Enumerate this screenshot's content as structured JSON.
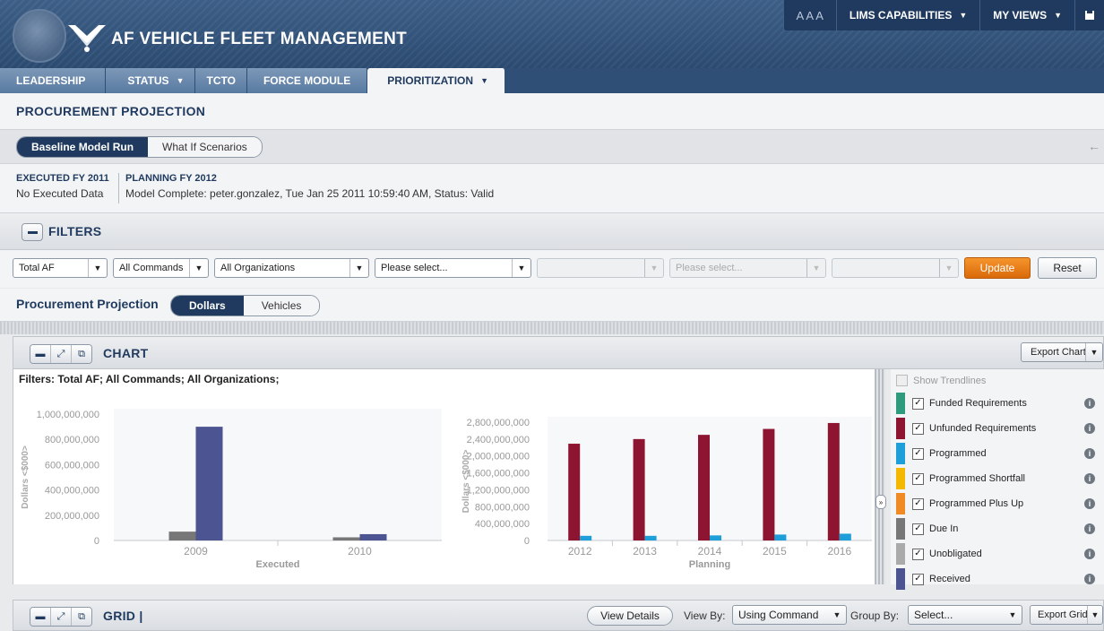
{
  "header": {
    "app_title": "AF VEHICLE FLEET MANAGEMENT",
    "font_size_control": "A A A",
    "menu": [
      "LIMS CAPABILITIES",
      "MY VIEWS"
    ]
  },
  "tabs": [
    {
      "label": "LEADERSHIP",
      "dropdown": false
    },
    {
      "label": "STATUS",
      "dropdown": true
    },
    {
      "label": "TCTO",
      "dropdown": false
    },
    {
      "label": "FORCE MODULE",
      "dropdown": false
    },
    {
      "label": "PRIORITIZATION",
      "dropdown": true,
      "active": true
    }
  ],
  "page_title": "PROCUREMENT PROJECTION",
  "mode_toggle": {
    "options": [
      "Baseline Model Run",
      "What If Scenarios"
    ],
    "selected": "Baseline Model Run"
  },
  "status": {
    "executed_label": "EXECUTED FY 2011",
    "executed_value": "No Executed Data",
    "planning_label": "PLANNING FY 2012",
    "planning_value": "Model Complete: peter.gonzalez, Tue Jan 25 2011 10:59:40 AM, Status: Valid"
  },
  "filters": {
    "title": "FILTERS",
    "selects": [
      "Total AF",
      "All Commands",
      "All Organizations",
      "Please select...",
      "",
      "Please select...",
      ""
    ],
    "update_label": "Update",
    "reset_label": "Reset"
  },
  "projection": {
    "label": "Procurement Projection",
    "options": [
      "Dollars",
      "Vehicles"
    ],
    "selected": "Dollars"
  },
  "chart_panel": {
    "title": "CHART",
    "export_label": "Export Chart",
    "filters_text": "Filters: Total AF;  All Commands;  All Organizations;",
    "show_trendlines": "Show Trendlines"
  },
  "legend": [
    {
      "label": "Funded Requirements",
      "color": "#2e9a7e",
      "checked": true
    },
    {
      "label": "Unfunded Requirements",
      "color": "#8e1531",
      "checked": true
    },
    {
      "label": "Programmed",
      "color": "#1f9fd9",
      "checked": true
    },
    {
      "label": "Programmed Shortfall",
      "color": "#f5b800",
      "checked": true
    },
    {
      "label": "Programmed Plus Up",
      "color": "#f08a24",
      "checked": true
    },
    {
      "label": "Due In",
      "color": "#777777",
      "checked": true
    },
    {
      "label": "Unobligated",
      "color": "#aaaaaa",
      "checked": true
    },
    {
      "label": "Received",
      "color": "#4c5591",
      "checked": true
    }
  ],
  "chart_data": [
    {
      "type": "bar",
      "xlabel": "Executed",
      "ylabel": "Dollars <$000>",
      "ylim": [
        0,
        1000000000
      ],
      "yticks": [
        "1,000,000,000",
        "800,000,000",
        "600,000,000",
        "400,000,000",
        "200,000,000",
        "0"
      ],
      "categories": [
        "2009",
        "2010"
      ],
      "series": [
        {
          "name": "Due In",
          "color": "#777777",
          "values": [
            70000000,
            25000000
          ]
        },
        {
          "name": "Received",
          "color": "#4c5591",
          "values": [
            900000000,
            50000000
          ]
        }
      ]
    },
    {
      "type": "bar",
      "xlabel": "Planning",
      "ylabel": "Dollars <$000>",
      "ylim": [
        0,
        2800000000
      ],
      "yticks": [
        "2,800,000,000",
        "2,400,000,000",
        "2,000,000,000",
        "1,600,000,000",
        "1,200,000,000",
        "800,000,000",
        "400,000,000",
        "0"
      ],
      "categories": [
        "2012",
        "2013",
        "2014",
        "2015",
        "2016"
      ],
      "series": [
        {
          "name": "Unfunded Requirements",
          "color": "#8e1531",
          "values": [
            2290000000,
            2400000000,
            2500000000,
            2640000000,
            2780000000
          ]
        },
        {
          "name": "Programmed",
          "color": "#1f9fd9",
          "values": [
            110000000,
            110000000,
            120000000,
            140000000,
            160000000
          ]
        }
      ]
    }
  ],
  "grid_panel": {
    "title": "GRID",
    "view_details": "View Details",
    "view_by_label": "View By:",
    "view_by_value": "Using Command",
    "group_by_label": "Group By:",
    "group_by_value": "Select...",
    "export_label": "Export Grid"
  }
}
